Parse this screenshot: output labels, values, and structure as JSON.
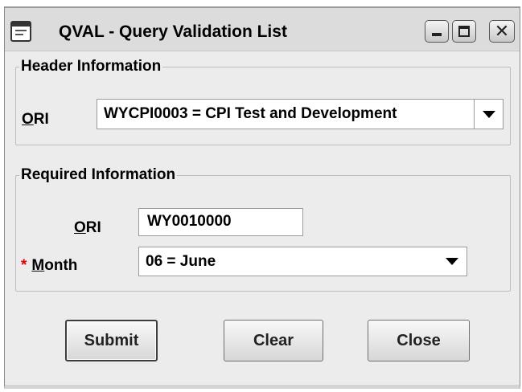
{
  "window": {
    "title": "QVAL - Query Validation List",
    "controls": {
      "minimize_icon": "minimize-icon",
      "maximize_icon": "maximize-icon",
      "close_icon": "close-icon",
      "close_glyph": "✕"
    }
  },
  "header_section": {
    "legend": "Header Information",
    "ori": {
      "mnemonic": "O",
      "label_rest": "RI",
      "selected": "WYCPI0003 = CPI Test and Development"
    }
  },
  "required_section": {
    "legend": "Required Information",
    "ori": {
      "mnemonic": "O",
      "label_rest": "RI",
      "value": "WY0010000"
    },
    "month": {
      "required_marker": "*",
      "mnemonic": "M",
      "label_rest": "onth",
      "selected": "06 = June"
    }
  },
  "buttons": {
    "submit": "Submit",
    "clear": "Clear",
    "close": "Close"
  },
  "colors": {
    "required_marker": "#e00000",
    "window_background": "#ececec"
  }
}
